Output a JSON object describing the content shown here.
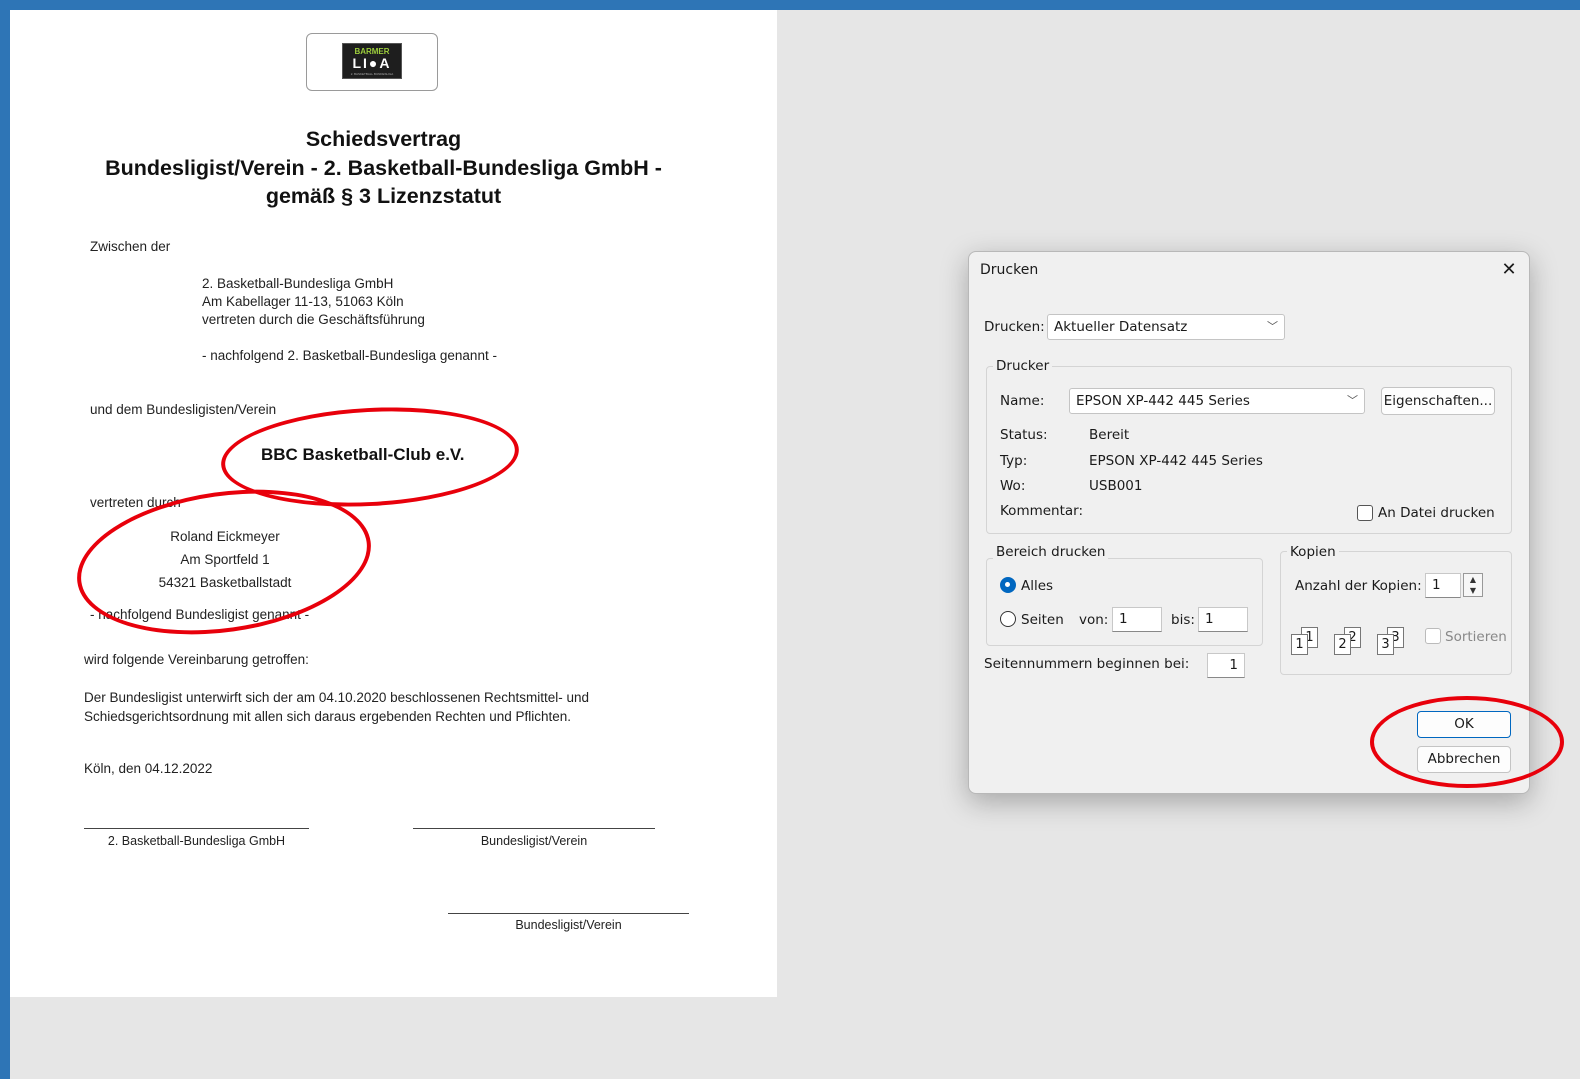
{
  "document": {
    "logo": {
      "line1": "BARMER",
      "line2": "LI●A",
      "tag": "2. BASKETBALL BUNDESLIGA"
    },
    "title_lines": [
      "Schiedsvertrag",
      "Bundesligist/Verein - 2. Basketball-Bundesliga GmbH -",
      "gemäß § 3 Lizenzstatut"
    ],
    "between": "Zwischen der",
    "party1": [
      "2. Basketball-Bundesliga GmbH",
      "Am Kabellager 11-13,  51063 Köln",
      "vertreten durch die Geschäftsführung"
    ],
    "party1_named": "-  nachfolgend 2. Basketball-Bundesliga genannt  -",
    "and_club": "und dem Bundesligisten/Verein",
    "club_name": "BBC Basketball-Club e.V.",
    "represented_by": "vertreten durch",
    "representative": [
      "Roland Eickmeyer",
      "Am Sportfeld 1",
      "54321 Basketballstadt"
    ],
    "party2_named": "-  nachfolgend Bundesligist genannt  -",
    "agreement": "wird folgende Vereinbarung getroffen:",
    "body": [
      "Der Bundesligist unterwirft sich der am 04.10.2020 beschlossenen Rechtsmittel- und",
      "Schiedsgerichtsordnung mit allen sich daraus ergebenden Rechten und Pflichten."
    ],
    "place_date": "Köln, den  04.12.2022",
    "sig_left": "2. Basketball-Bundesliga GmbH",
    "sig_right": "Bundesligist/Verein",
    "sig_bottom": "Bundesligist/Verein"
  },
  "dialog": {
    "title": "Drucken",
    "close_icon": "close-icon",
    "print_label": "Drucken:",
    "print_value": "Aktueller Datensatz",
    "printer_group": "Drucker",
    "name_label": "Name:",
    "name_value": "EPSON XP-442 445 Series",
    "properties_button": "Eigenschaften...",
    "status_label": "Status:",
    "status_value": "Bereit",
    "type_label": "Typ:",
    "type_value": "EPSON XP-442 445 Series",
    "where_label": "Wo:",
    "where_value": "USB001",
    "comment_label": "Kommentar:",
    "print_to_file": "An Datei drucken",
    "range_group": "Bereich drucken",
    "all_label": "Alles",
    "pages_label": "Seiten",
    "from_label": "von:",
    "from_value": "1",
    "to_label": "bis:",
    "to_value": "1",
    "copies_group": "Kopien",
    "copies_label": "Anzahl der Kopien:",
    "copies_value": "1",
    "collate_label": "Sortieren",
    "page_numbers": [
      "1",
      "1",
      "2",
      "2",
      "3",
      "3"
    ],
    "page_start_label": "Seitennummern beginnen bei:",
    "page_start_value": "1",
    "ok_button": "OK",
    "cancel_button": "Abbrechen"
  },
  "colors": {
    "frame": "#2e75b6",
    "highlight": "#e8000b",
    "accent": "#0067c0"
  }
}
